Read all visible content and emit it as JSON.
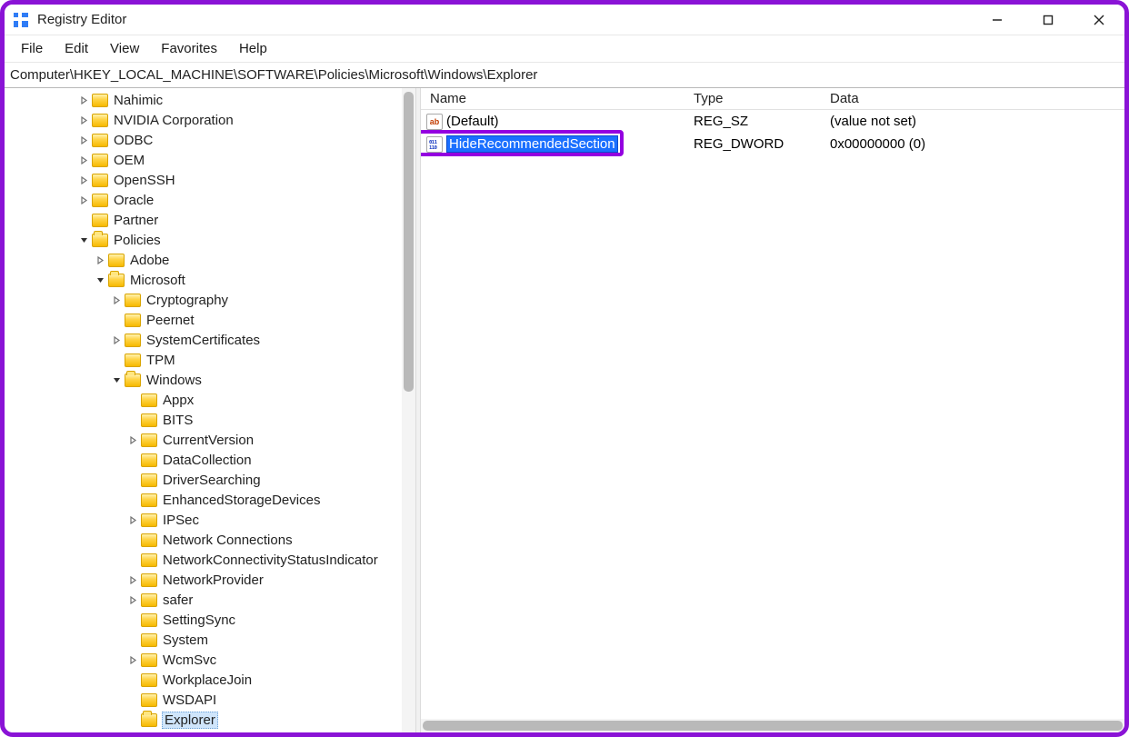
{
  "window": {
    "title": "Registry Editor"
  },
  "menus": [
    "File",
    "Edit",
    "View",
    "Favorites",
    "Help"
  ],
  "addressbar": "Computer\\HKEY_LOCAL_MACHINE\\SOFTWARE\\Policies\\Microsoft\\Windows\\Explorer",
  "tree": [
    {
      "indent": 4,
      "exp": ">",
      "label": "Nahimic"
    },
    {
      "indent": 4,
      "exp": ">",
      "label": "NVIDIA Corporation"
    },
    {
      "indent": 4,
      "exp": ">",
      "label": "ODBC"
    },
    {
      "indent": 4,
      "exp": ">",
      "label": "OEM"
    },
    {
      "indent": 4,
      "exp": ">",
      "label": "OpenSSH"
    },
    {
      "indent": 4,
      "exp": ">",
      "label": "Oracle"
    },
    {
      "indent": 4,
      "exp": "",
      "label": "Partner"
    },
    {
      "indent": 4,
      "exp": "v",
      "label": "Policies",
      "open": true
    },
    {
      "indent": 5,
      "exp": ">",
      "label": "Adobe"
    },
    {
      "indent": 5,
      "exp": "v",
      "label": "Microsoft",
      "open": true
    },
    {
      "indent": 6,
      "exp": ">",
      "label": "Cryptography"
    },
    {
      "indent": 6,
      "exp": "",
      "label": "Peernet"
    },
    {
      "indent": 6,
      "exp": ">",
      "label": "SystemCertificates"
    },
    {
      "indent": 6,
      "exp": "",
      "label": "TPM"
    },
    {
      "indent": 6,
      "exp": "v",
      "label": "Windows",
      "open": true
    },
    {
      "indent": 7,
      "exp": "",
      "label": "Appx"
    },
    {
      "indent": 7,
      "exp": "",
      "label": "BITS"
    },
    {
      "indent": 7,
      "exp": ">",
      "label": "CurrentVersion"
    },
    {
      "indent": 7,
      "exp": "",
      "label": "DataCollection"
    },
    {
      "indent": 7,
      "exp": "",
      "label": "DriverSearching"
    },
    {
      "indent": 7,
      "exp": "",
      "label": "EnhancedStorageDevices"
    },
    {
      "indent": 7,
      "exp": ">",
      "label": "IPSec"
    },
    {
      "indent": 7,
      "exp": "",
      "label": "Network Connections"
    },
    {
      "indent": 7,
      "exp": "",
      "label": "NetworkConnectivityStatusIndicator"
    },
    {
      "indent": 7,
      "exp": ">",
      "label": "NetworkProvider"
    },
    {
      "indent": 7,
      "exp": ">",
      "label": "safer"
    },
    {
      "indent": 7,
      "exp": "",
      "label": "SettingSync"
    },
    {
      "indent": 7,
      "exp": "",
      "label": "System"
    },
    {
      "indent": 7,
      "exp": ">",
      "label": "WcmSvc"
    },
    {
      "indent": 7,
      "exp": "",
      "label": "WorkplaceJoin"
    },
    {
      "indent": 7,
      "exp": "",
      "label": "WSDAPI"
    },
    {
      "indent": 7,
      "exp": "",
      "label": "Explorer",
      "selected": true,
      "open": true
    }
  ],
  "columns": {
    "name": "Name",
    "type": "Type",
    "data": "Data"
  },
  "values": [
    {
      "kind": "str",
      "name": "(Default)",
      "type": "REG_SZ",
      "data": "(value not set)",
      "editing": false
    },
    {
      "kind": "dword",
      "name": "HideRecommendedSection",
      "type": "REG_DWORD",
      "data": "0x00000000 (0)",
      "editing": true
    }
  ],
  "iconLabels": {
    "str": "ab",
    "dword": "011\n110"
  }
}
